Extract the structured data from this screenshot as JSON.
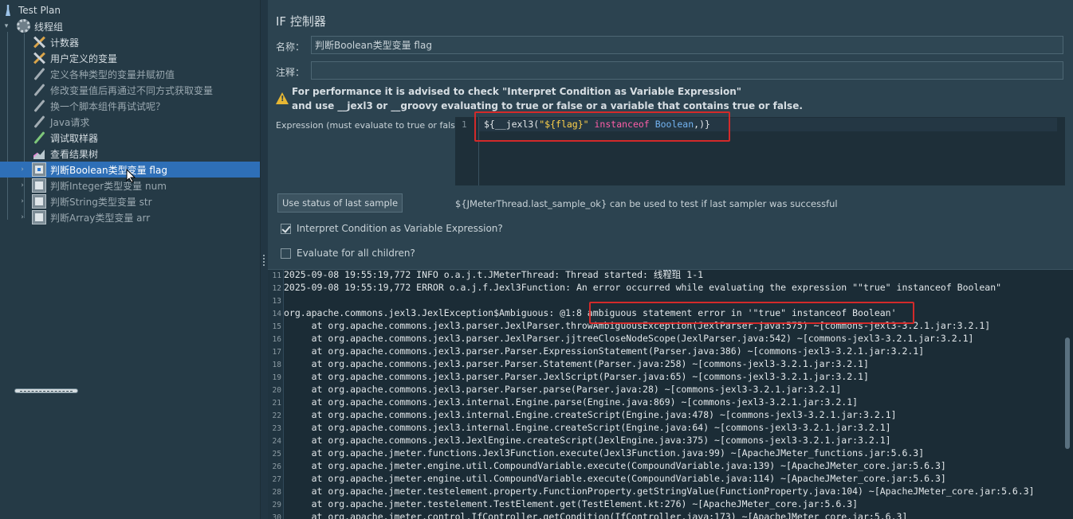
{
  "tree": {
    "items": [
      {
        "label": "Test Plan",
        "icon": "flask-icon",
        "twisty": "",
        "active": true
      },
      {
        "label": "线程组",
        "icon": "gear-icon",
        "twisty": "▾",
        "active": true
      },
      {
        "label": "计数器",
        "icon": "tools-icon",
        "twisty": "",
        "active": true
      },
      {
        "label": "用户定义的变量",
        "icon": "tools-icon",
        "twisty": "",
        "active": true
      },
      {
        "label": "定义各种类型的变量并赋初值",
        "icon": "pen-icon",
        "twisty": "",
        "active": false
      },
      {
        "label": "修改变量值后再通过不同方式获取变量",
        "icon": "pen-icon",
        "twisty": "",
        "active": false
      },
      {
        "label": "换一个脚本组件再试试呢？",
        "icon": "pen-icon",
        "twisty": "",
        "active": false
      },
      {
        "label": "Java请求",
        "icon": "pen-icon",
        "twisty": "",
        "active": false
      },
      {
        "label": "调试取样器",
        "icon": "pen-green-icon",
        "twisty": "",
        "active": true
      },
      {
        "label": "查看结果树",
        "icon": "chart-icon",
        "twisty": "",
        "active": true
      },
      {
        "label": "判断Boolean类型变量 flag",
        "icon": "if-controller-icon",
        "twisty": "›",
        "active": true,
        "selected": true
      },
      {
        "label": "判断Integer类型变量 num",
        "icon": "if-controller-icon",
        "twisty": "›",
        "active": false
      },
      {
        "label": "判断String类型变量 str",
        "icon": "if-controller-icon",
        "twisty": "›",
        "active": false
      },
      {
        "label": "判断Array类型变量 arr",
        "icon": "if-controller-icon",
        "twisty": "›",
        "active": false
      }
    ]
  },
  "panel": {
    "title": "IF 控制器",
    "name_label": "名称：",
    "name_value": "判断Boolean类型变量 flag",
    "comment_label": "注释：",
    "comment_value": "",
    "warning_line1": "For performance it is advised to check \"Interpret Condition as Variable Expression\"",
    "warning_line2": "and use __jexl3 or __groovy evaluating to true or false or a variable that contains true or false.",
    "expression_label": "Expression (must evaluate to true or false)",
    "expression_line_number": "1",
    "expression": {
      "p1": "${__jexl3(",
      "p2": "\"${flag}\"",
      "p3": " ",
      "p4": "instanceof",
      "p5": " ",
      "p6": "Boolean",
      "p7": ",)}"
    },
    "button_label": "Use status of last sample",
    "hint": "${JMeterThread.last_sample_ok} can be used to test if last sampler was successful",
    "checkbox1_label": "Interpret Condition as Variable Expression?",
    "checkbox1_checked": true,
    "checkbox2_label": "Evaluate for all children?",
    "checkbox2_checked": false
  },
  "log": {
    "lines": [
      {
        "n": "11",
        "text": "2025-09-08 19:55:19,772 INFO o.a.j.t.JMeterThread: Thread started: 线程组 1-1"
      },
      {
        "n": "12",
        "text": "2025-09-08 19:55:19,772 ERROR o.a.j.f.Jexl3Function: An error occurred while evaluating the expression \"\"true\" instanceof Boolean\""
      },
      {
        "n": "13",
        "text": ""
      },
      {
        "n": "14",
        "text": "org.apache.commons.jexl3.JexlException$Ambiguous: @1:8 ambiguous statement error in '\"true\" instanceof Boolean'"
      },
      {
        "n": "15",
        "text": "     at org.apache.commons.jexl3.parser.JexlParser.throwAmbiguousException(JexlParser.java:575) ~[commons-jexl3-3.2.1.jar:3.2.1]"
      },
      {
        "n": "16",
        "text": "     at org.apache.commons.jexl3.parser.JexlParser.jjtreeCloseNodeScope(JexlParser.java:542) ~[commons-jexl3-3.2.1.jar:3.2.1]"
      },
      {
        "n": "17",
        "text": "     at org.apache.commons.jexl3.parser.Parser.ExpressionStatement(Parser.java:386) ~[commons-jexl3-3.2.1.jar:3.2.1]"
      },
      {
        "n": "18",
        "text": "     at org.apache.commons.jexl3.parser.Parser.Statement(Parser.java:258) ~[commons-jexl3-3.2.1.jar:3.2.1]"
      },
      {
        "n": "19",
        "text": "     at org.apache.commons.jexl3.parser.Parser.JexlScript(Parser.java:65) ~[commons-jexl3-3.2.1.jar:3.2.1]"
      },
      {
        "n": "20",
        "text": "     at org.apache.commons.jexl3.parser.Parser.parse(Parser.java:28) ~[commons-jexl3-3.2.1.jar:3.2.1]"
      },
      {
        "n": "21",
        "text": "     at org.apache.commons.jexl3.internal.Engine.parse(Engine.java:869) ~[commons-jexl3-3.2.1.jar:3.2.1]"
      },
      {
        "n": "22",
        "text": "     at org.apache.commons.jexl3.internal.Engine.createScript(Engine.java:478) ~[commons-jexl3-3.2.1.jar:3.2.1]"
      },
      {
        "n": "23",
        "text": "     at org.apache.commons.jexl3.internal.Engine.createScript(Engine.java:64) ~[commons-jexl3-3.2.1.jar:3.2.1]"
      },
      {
        "n": "24",
        "text": "     at org.apache.commons.jexl3.JexlEngine.createScript(JexlEngine.java:375) ~[commons-jexl3-3.2.1.jar:3.2.1]"
      },
      {
        "n": "25",
        "text": "     at org.apache.jmeter.functions.Jexl3Function.execute(Jexl3Function.java:99) ~[ApacheJMeter_functions.jar:5.6.3]"
      },
      {
        "n": "26",
        "text": "     at org.apache.jmeter.engine.util.CompoundVariable.execute(CompoundVariable.java:139) ~[ApacheJMeter_core.jar:5.6.3]"
      },
      {
        "n": "27",
        "text": "     at org.apache.jmeter.engine.util.CompoundVariable.execute(CompoundVariable.java:114) ~[ApacheJMeter_core.jar:5.6.3]"
      },
      {
        "n": "28",
        "text": "     at org.apache.jmeter.testelement.property.FunctionProperty.getStringValue(FunctionProperty.java:104) ~[ApacheJMeter_core.jar:5.6.3]"
      },
      {
        "n": "29",
        "text": "     at org.apache.jmeter.testelement.TestElement.get(TestElement.kt:276) ~[ApacheJMeter_core.jar:5.6.3]"
      },
      {
        "n": "30",
        "text": "     at org.apache.jmeter.control.IfController.getCondition(IfController.java:173) ~[ApacheJMeter_core.jar:5.6.3]"
      }
    ]
  },
  "colors": {
    "selection": "#2e6fb7",
    "highlight_box": "#d32a2a",
    "keyword": "#ff5ea8",
    "string": "#ffd24a",
    "type": "#73b4f2"
  }
}
